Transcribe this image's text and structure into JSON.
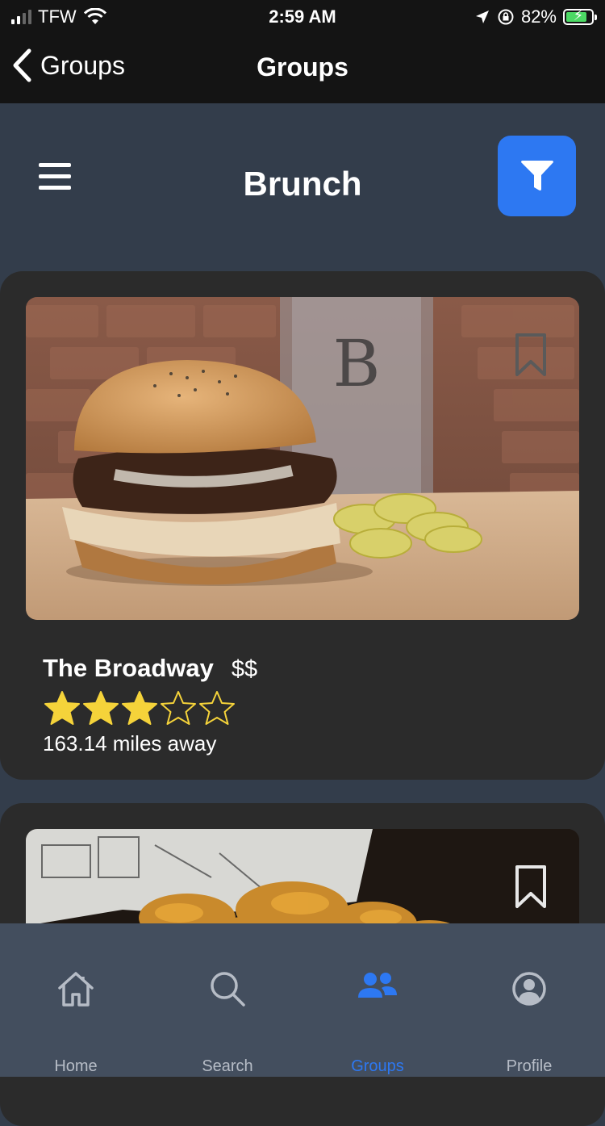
{
  "status_bar": {
    "carrier": "TFW",
    "time": "2:59 AM",
    "battery": "82%",
    "battery_level": 0.82
  },
  "nav": {
    "back_label": "Groups",
    "title": "Groups"
  },
  "header": {
    "title": "Brunch",
    "menu_icon": "hamburger-menu-icon",
    "filter_icon": "filter-funnel-icon",
    "accent_color": "#2d78f2"
  },
  "restaurants": [
    {
      "name": "The Broadway",
      "price": "$$",
      "rating": 3,
      "rating_max": 5,
      "distance": "163.14 miles away",
      "image": "burger-photo"
    },
    {
      "image": "fried-food-photo"
    }
  ],
  "tabs": [
    {
      "label": "Home",
      "icon": "home-icon"
    },
    {
      "label": "Search",
      "icon": "search-icon"
    },
    {
      "label": "Groups",
      "icon": "groups-icon",
      "active": true
    },
    {
      "label": "Profile",
      "icon": "profile-icon"
    }
  ],
  "colors": {
    "star": "#f5d33a",
    "tab_active": "#2d78f2",
    "tab_inactive": "#b6bcc6"
  }
}
